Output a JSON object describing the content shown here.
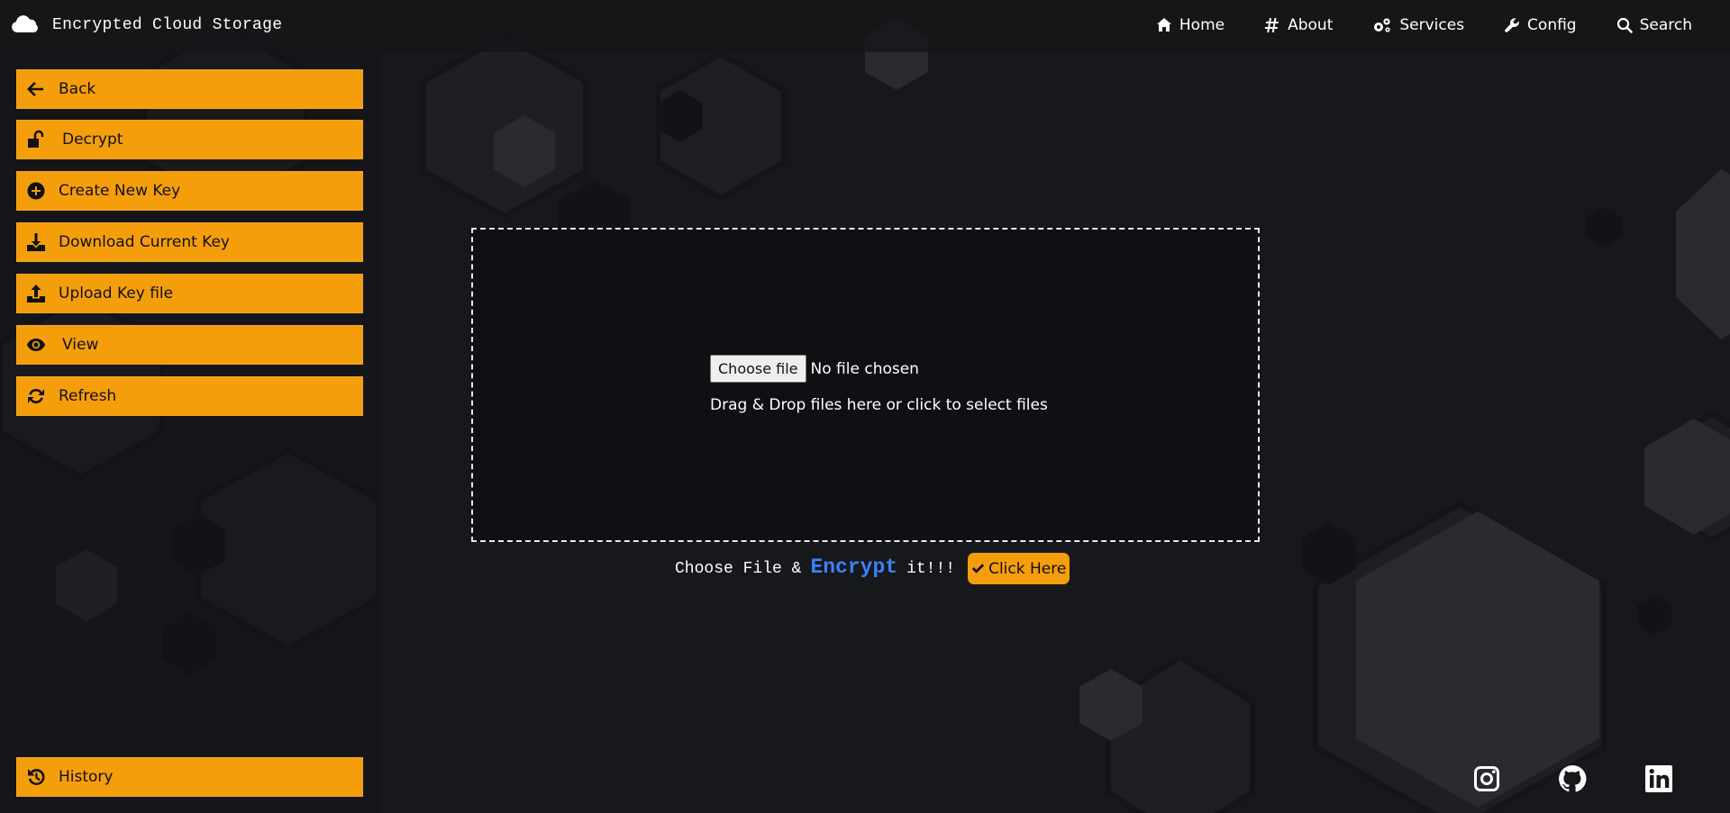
{
  "app": {
    "title": "Encrypted Cloud Storage",
    "icon": "cloud-icon"
  },
  "nav": [
    {
      "label": "Home",
      "icon": "home-icon"
    },
    {
      "label": "About",
      "icon": "hash-icon"
    },
    {
      "label": "Services",
      "icon": "gears-icon"
    },
    {
      "label": "Config",
      "icon": "wrench-icon"
    },
    {
      "label": "Search",
      "icon": "search-icon"
    }
  ],
  "sidebar": {
    "items": [
      {
        "label": "Back",
        "icon": "arrow-left-icon"
      },
      {
        "label": "Decrypt",
        "icon": "unlock-icon"
      },
      {
        "label": "Create New Key",
        "icon": "plus-circle-icon"
      },
      {
        "label": "Download Current Key",
        "icon": "download-icon"
      },
      {
        "label": "Upload Key file",
        "icon": "upload-icon"
      },
      {
        "label": "View",
        "icon": "eye-icon"
      },
      {
        "label": "Refresh",
        "icon": "refresh-icon"
      }
    ],
    "history": {
      "label": "History",
      "icon": "history-icon"
    }
  },
  "dropzone": {
    "choose_label": "Choose file",
    "status": "No file chosen",
    "hint": "Drag & Drop files here or click to select files"
  },
  "encrypt": {
    "prefix": "Choose File &",
    "highlight": "Encrypt",
    "suffix": "it!!!",
    "button_label": "Click Here",
    "button_icon": "check-icon"
  },
  "social": [
    {
      "name": "instagram-icon"
    },
    {
      "name": "github-icon"
    },
    {
      "name": "linkedin-icon"
    }
  ],
  "colors": {
    "accent": "#f59e0b",
    "highlight": "#3b82f6",
    "background": "#17181b",
    "dropzone": "#0f1013"
  }
}
